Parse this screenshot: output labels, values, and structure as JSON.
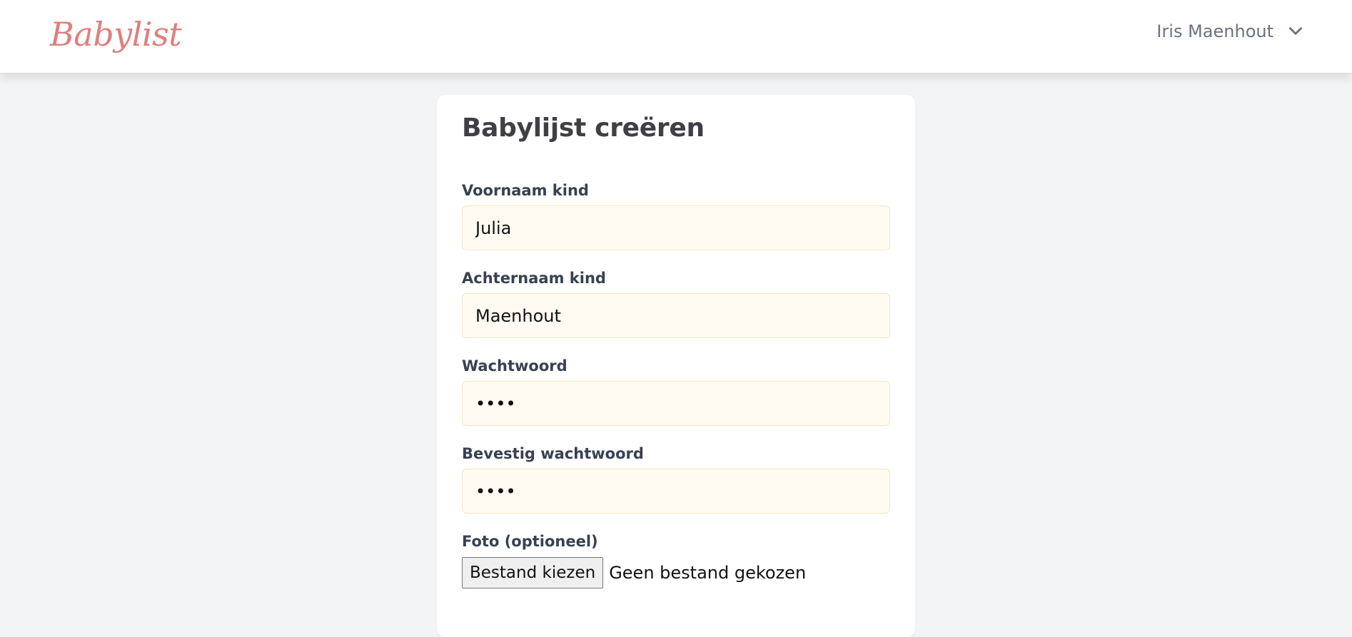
{
  "header": {
    "brand": "Babylist",
    "user_name": "Iris Maenhout",
    "menu_icon": "chevron-down-icon"
  },
  "form": {
    "title": "Babylijst creëren",
    "first_name": {
      "label": "Voornaam kind",
      "value": "Julia"
    },
    "last_name": {
      "label": "Achternaam kind",
      "value": "Maenhout"
    },
    "password": {
      "label": "Wachtwoord",
      "value": "abcd"
    },
    "confirm_password": {
      "label": "Bevestig wachtwoord",
      "value": "abcd"
    },
    "photo": {
      "label": "Foto (optioneel)",
      "button_label": "Bestand kiezen",
      "status": "Geen bestand gekozen"
    }
  },
  "colors": {
    "brand": "#e07e7e",
    "page_background": "#f3f4f6",
    "input_background": "#fffbf2",
    "input_border": "#f3e6c2"
  }
}
